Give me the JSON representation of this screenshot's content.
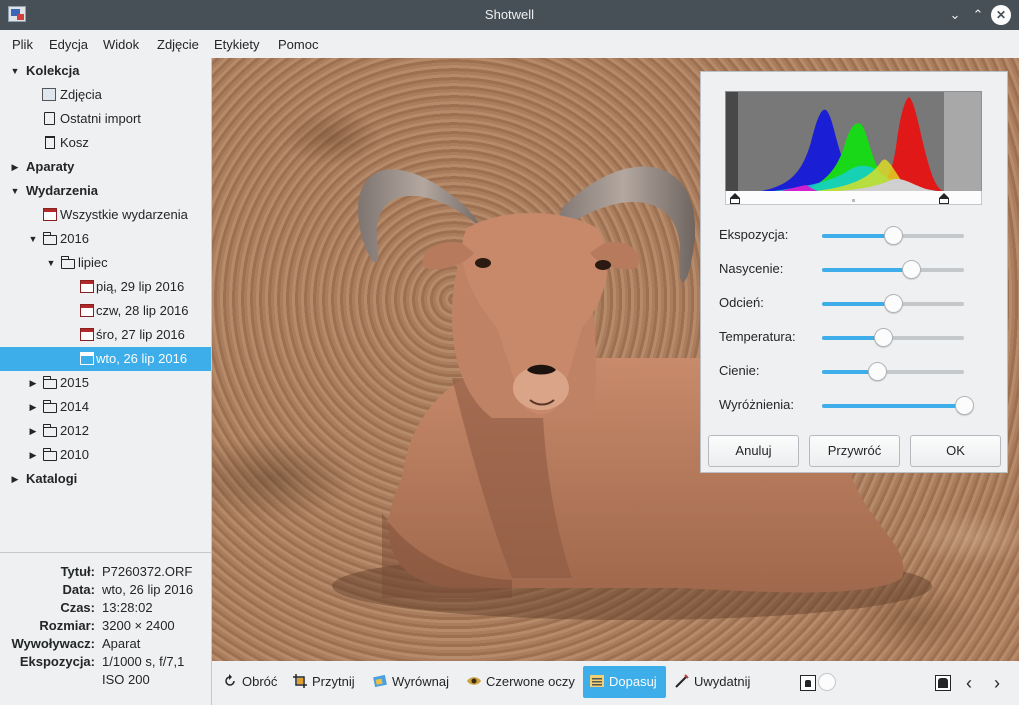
{
  "window": {
    "title": "Shotwell"
  },
  "menu": [
    "Plik",
    "Edycja",
    "Widok",
    "Zdjęcie",
    "Etykiety",
    "Pomoc"
  ],
  "sidebar": {
    "collection": {
      "label": "Kolekcja",
      "items": [
        "Zdjęcia",
        "Ostatni import",
        "Kosz"
      ]
    },
    "cameras": {
      "label": "Aparaty"
    },
    "events": {
      "label": "Wydarzenia",
      "all_events": "Wszystkie wydarzenia",
      "year_2016": "2016",
      "month": "lipiec",
      "days": [
        "pią, 29 lip 2016",
        "czw, 28 lip 2016",
        "śro, 27 lip 2016",
        "wto, 26 lip 2016"
      ],
      "other_years": [
        "2015",
        "2014",
        "2012",
        "2010"
      ]
    },
    "catalogs": {
      "label": "Katalogi"
    },
    "selected_item": "wto, 26 lip 2016"
  },
  "info": {
    "title_label": "Tytuł:",
    "title_value": "P7260372.ORF",
    "date_label": "Data:",
    "date_value": "wto, 26 lip 2016",
    "time_label": "Czas:",
    "time_value": "13:28:02",
    "size_label": "Rozmiar:",
    "size_value": "3200 × 2400",
    "developer_label": "Wywoływacz:",
    "developer_value": "Aparat",
    "exposure_label": "Ekspozycja:",
    "exposure_value_1": "1/1000 s, f/7,1",
    "exposure_value_2": "ISO 200"
  },
  "adjust": {
    "sliders": [
      {
        "label": "Ekspozycja:",
        "value": 0.5
      },
      {
        "label": "Nasycenie:",
        "value": 0.63
      },
      {
        "label": "Odcień:",
        "value": 0.5
      },
      {
        "label": "Temperatura:",
        "value": 0.43
      },
      {
        "label": "Cienie:",
        "value": 0.39
      },
      {
        "label": "Wyróżnienia:",
        "value": 1.0
      }
    ],
    "cancel": "Anuluj",
    "reset": "Przywróć",
    "ok": "OK"
  },
  "toolbar": {
    "rotate": "Obróć",
    "crop": "Przytnij",
    "straighten": "Wyrównaj",
    "red_eye": "Czerwone oczy",
    "adjust": "Dopasuj",
    "enhance": "Uwydatnij"
  },
  "colors": {
    "accent": "#3daee9",
    "titlebar": "#475057",
    "window": "#eff0f1"
  }
}
